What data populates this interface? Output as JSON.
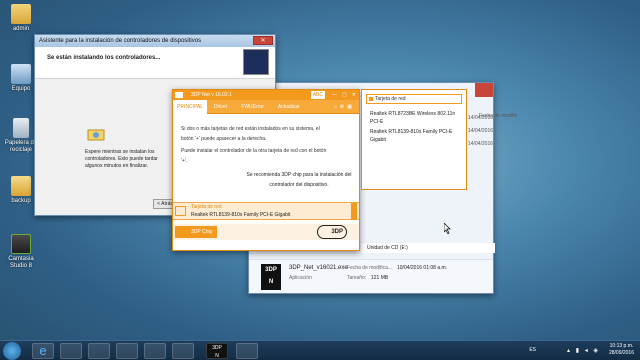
{
  "desktop": {
    "icons": [
      {
        "label": "admin"
      },
      {
        "label": "Equipo"
      },
      {
        "label": "Papelera de reciclaje"
      },
      {
        "label": "backup"
      },
      {
        "label": "Camtasia Studio 8"
      }
    ]
  },
  "wizard": {
    "title": "Asistente para la instalación de controladores de dispositivos",
    "heading": "Se están instalando los controladores...",
    "body": "Espere mientras se instalan los controladores. Esto puede tardar algunos minutos en finalizar.",
    "back_button": "< Atrás"
  },
  "explorer": {
    "side_dates": [
      "Fecha de modific",
      "14/04/2016 02",
      "14/04/2016 03",
      "14/04/2016 03"
    ],
    "drive_label": "Unidad de CD (E:)",
    "file_name": "3DP_Net_v16021.exe",
    "modified_label": "Fecha de modifica...",
    "modified_value": "10/04/2016 01:08 a.m.",
    "type_label": "Aplicación",
    "size_label": "Tamaño:",
    "size_value": "121 MB"
  },
  "app": {
    "title": "3DP Net v 16.02.1",
    "abc_label": "ABC",
    "tabs": [
      "PRINCIPAL",
      "Driver",
      "FWUError",
      "Actualizar"
    ],
    "paragraph1": "Si dos o más tarjetas de red están instalados en su sistema, el botón '+' puede aparecer a la derecha.",
    "paragraph2": "Puede instalar el controlador de la otra tarjeta de red con el botón '+'.",
    "recommend": "Se recomienda 3DP chip para la instalación del controlador del dispositivo.",
    "card_title": "Tarjeta de red",
    "card_value": "Realtek RTL8139-810x Family PCI-E Gigabit",
    "chip_button": "3DP Chip",
    "logo_text": "3DP",
    "panel_header": "Tarjeta de red",
    "drivers": [
      "Realtek RTL8723BE Wireless 802.11n PCI-E",
      "Realtek RTL8139-810x Family PCI-E Gigabit"
    ]
  },
  "taskbar": {
    "lang": "ES",
    "time": "10:13 p.m.",
    "date": "28/09/2016"
  },
  "colors": {
    "accent_orange": "#f39a1e",
    "titlebar_blue": "#a9c5e2"
  }
}
